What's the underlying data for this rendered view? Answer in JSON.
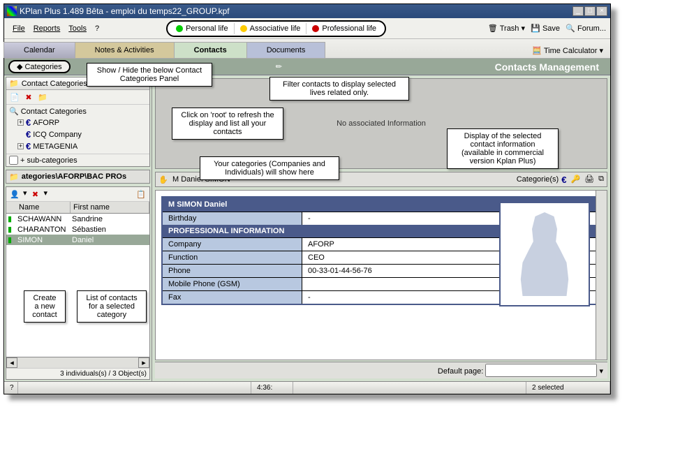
{
  "title": "KPlan Plus 1.489 Bêta - emploi du temps22_GROUP.kpf",
  "menu": {
    "file": "File",
    "reports": "Reports",
    "tools": "Tools",
    "help": "?"
  },
  "filters": {
    "personal": "Personal life",
    "associative": "Associative life",
    "professional": "Professional life"
  },
  "tools": {
    "trash": "Trash",
    "save": "Save",
    "forum": "Forum...",
    "timecalc": "Time Calculator"
  },
  "tabs": {
    "calendar": "Calendar",
    "notes": "Notes & Activities",
    "contacts": "Contacts",
    "documents": "Documents"
  },
  "header": {
    "categories": "Categories",
    "title": "Contacts Management"
  },
  "catpanel": {
    "title": "Contact Categories",
    "root": "Contact Categories",
    "items": [
      "AFORP",
      "ICQ Company",
      "METAGENIA"
    ],
    "subcheck": "+ sub-categories"
  },
  "path": "ategories\\AFORP\\BAC PROs",
  "list": {
    "cols": {
      "name": "Name",
      "first": "First name"
    },
    "rows": [
      {
        "name": "SCHAWANN",
        "first": "Sandrine"
      },
      {
        "name": "CHARANTON",
        "first": "Sébastien"
      },
      {
        "name": "SIMON",
        "first": "Daniel"
      }
    ],
    "status": "3 individuals(s) / 3 Object(s)"
  },
  "info": "No associated Information",
  "detail": {
    "title": "M Daniel SIMON",
    "catlabel": "Categorie(s)",
    "card_title": "M SIMON Daniel",
    "section": "PROFESSIONAL INFORMATION",
    "rows": {
      "birthday_l": "Birthday",
      "birthday_v": "-",
      "company_l": "Company",
      "company_v": "AFORP",
      "function_l": "Function",
      "function_v": "CEO",
      "phone_l": "Phone",
      "phone_v": "00-33-01-44-56-76",
      "mobile_l": "Mobile Phone (GSM)",
      "mobile_v": "",
      "fax_l": "Fax",
      "fax_v": "-"
    },
    "defaultpage": "Default page:"
  },
  "status": {
    "time": "4:36:",
    "selected": "2 selected"
  },
  "callouts": {
    "c1": "Show / Hide the below Contact Categories Panel",
    "c2": "Filter contacts to display selected lives related only.",
    "c3": "Click on 'root' to refresh the display and list all your contacts",
    "c4": "Your categories (Companies and Individuals) will show here",
    "c5": "Display of the selected contact information (available in commercial version Kplan Plus)",
    "c6": "Create a new contact",
    "c7": "List of contacts for a selected category"
  }
}
